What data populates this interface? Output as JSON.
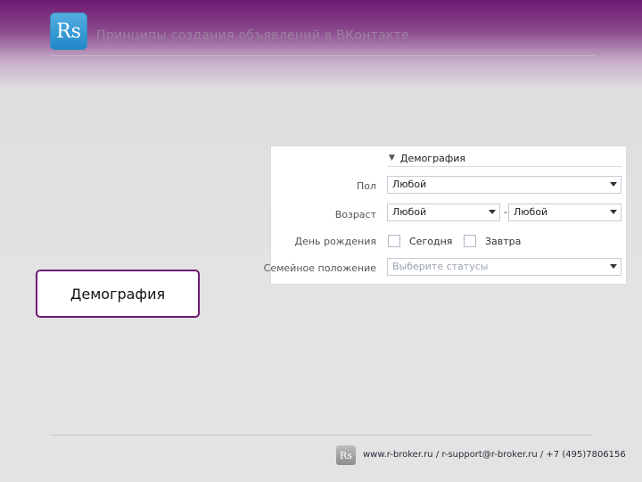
{
  "header": {
    "logo_text": "Rs",
    "title": "Принципы создания объявлений в ВКонтакте"
  },
  "panel": {
    "section_title": "Демография",
    "rows": {
      "gender": {
        "label": "Пол",
        "value": "Любой"
      },
      "age": {
        "label": "Возраст",
        "from_value": "Любой",
        "separator": "-",
        "to_value": "Любой"
      },
      "birthday": {
        "label": "День рождения",
        "today_label": "Сегодня",
        "tomorrow_label": "Завтра",
        "today_checked": false,
        "tomorrow_checked": false
      },
      "marital": {
        "label": "Семейное положение",
        "placeholder": "Выберите статусы"
      }
    }
  },
  "callout": {
    "text": "Демография"
  },
  "footer": {
    "logo_text": "Rs",
    "contacts": "www.r-broker.ru / r-support@r-broker.ru / +7 (495)7806156"
  },
  "colors": {
    "brand_purple": "#6e1a72",
    "panel_border": "#d7dbe3"
  }
}
